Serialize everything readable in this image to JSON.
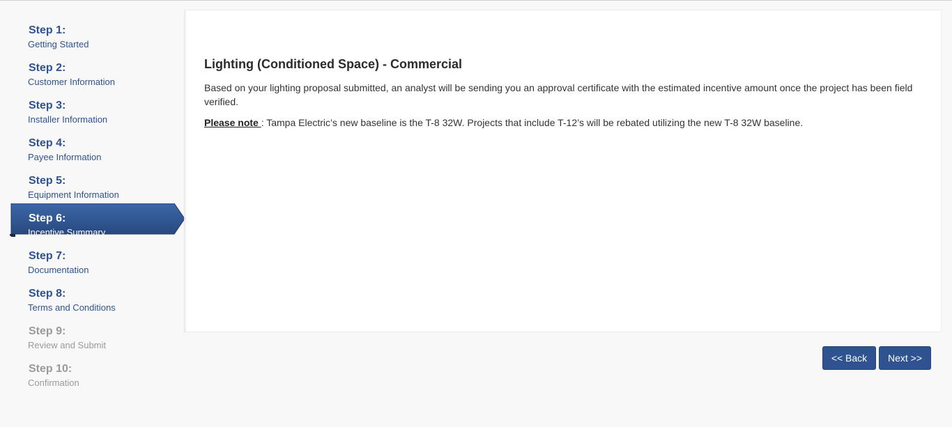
{
  "wizard": {
    "steps": [
      {
        "number": "Step 1:",
        "label": "Getting Started",
        "state": "complete"
      },
      {
        "number": "Step 2:",
        "label": "Customer Information",
        "state": "complete"
      },
      {
        "number": "Step 3:",
        "label": "Installer Information",
        "state": "complete"
      },
      {
        "number": "Step 4:",
        "label": "Payee Information",
        "state": "complete"
      },
      {
        "number": "Step 5:",
        "label": "Equipment Information",
        "state": "complete"
      },
      {
        "number": "Step 6:",
        "label": "Incentive Summary",
        "state": "active"
      },
      {
        "number": "Step 7:",
        "label": "Documentation",
        "state": "available"
      },
      {
        "number": "Step 8:",
        "label": "Terms and Conditions",
        "state": "available"
      },
      {
        "number": "Step 9:",
        "label": "Review and Submit",
        "state": "disabled"
      },
      {
        "number": "Step 10:",
        "label": "Confirmation",
        "state": "disabled"
      }
    ]
  },
  "content": {
    "title": "Lighting (Conditioned Space) - Commercial",
    "body": "Based on your lighting proposal submitted, an analyst will be sending you an approval certificate with the estimated incentive amount once the project has been field verified.",
    "note_label": "Please note ",
    "note_text": ": Tampa Electric’s new baseline is the T-8 32W. Projects that include T-12’s will be rebated utilizing the new T-8 32W baseline."
  },
  "navigation": {
    "back_label": "<< Back",
    "next_label": "Next >>"
  },
  "colors": {
    "primary": "#2e5390",
    "disabled": "#9a9a9a",
    "background": "#f8f8f8",
    "panel": "#ffffff"
  }
}
